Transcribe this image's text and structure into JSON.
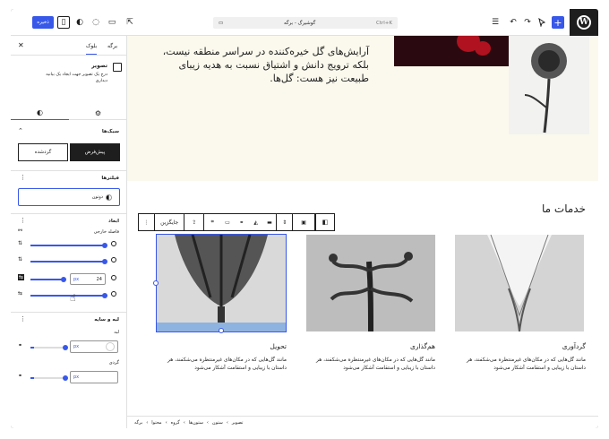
{
  "topbar": {
    "save_label": "ذخیره",
    "command": {
      "title": "گوشیرگ - برگه",
      "shortcut": "Ctrl+K"
    },
    "icons": [
      "wordpress-logo-icon",
      "add-block-icon",
      "select-tool-icon",
      "undo-icon",
      "redo-icon",
      "document-overview-icon",
      "settings-panel-icon",
      "contrast-icon",
      "view-icon",
      "external-link-icon"
    ]
  },
  "sidebar": {
    "tabs": {
      "page": "برگه",
      "block": "بلوک"
    },
    "block": {
      "title": "تصویر",
      "description": "درج یک تصویر جهت ایجاد یک بیانیه دیداری"
    },
    "styles": {
      "heading": "سبک‌ها",
      "default": "پیش‌فرض",
      "rounded": "گردشده"
    },
    "filters": {
      "heading": "فیلترها",
      "duotone": "دوتون"
    },
    "dimensions": {
      "heading": "ابعاد",
      "margin_label": "فاصله خارجی",
      "value": "24",
      "unit": "px"
    },
    "border": {
      "heading": "لبه و سایه",
      "border_label": "لبه",
      "radius_label": "گردی",
      "unit": "px"
    }
  },
  "canvas": {
    "hero_text": "آرایش‌های گل خیره‌کننده در سراسر منطقه نیست، بلکه ترویج دانش و اشتیاق نسبت به هدیه زیبای طبیعت نیز هست: گل‌ها.",
    "services_title": "خدمات ما",
    "toolbar": {
      "caption_label": "جایگزین"
    },
    "cards": [
      {
        "title": "گردآوری",
        "body": "مانند گل‌هایی که در مکان‌های غیرمنتظره می‌شکفند، هر داستان با زیبایی و استقامت آشکار می‌شود"
      },
      {
        "title": "هم‌گذاری",
        "body": "مانند گل‌هایی که در مکان‌های غیرمنتظره می‌شکفند، هر داستان با زیبایی و استقامت آشکار می‌شود"
      },
      {
        "title": "تحویل",
        "body": "مانند گل‌هایی که در مکان‌های غیرمنتظره می‌شکفند، هر داستان با زیبایی و استقامت آشکار می‌شود"
      }
    ]
  },
  "breadcrumbs": [
    "برگه",
    "محتوا",
    "گروه",
    "ستون‌ها",
    "ستون",
    "تصویر"
  ],
  "colors": {
    "accent": "#3858e9",
    "dark": "#1e1e1e",
    "hero_bg": "#fbf9ed"
  }
}
